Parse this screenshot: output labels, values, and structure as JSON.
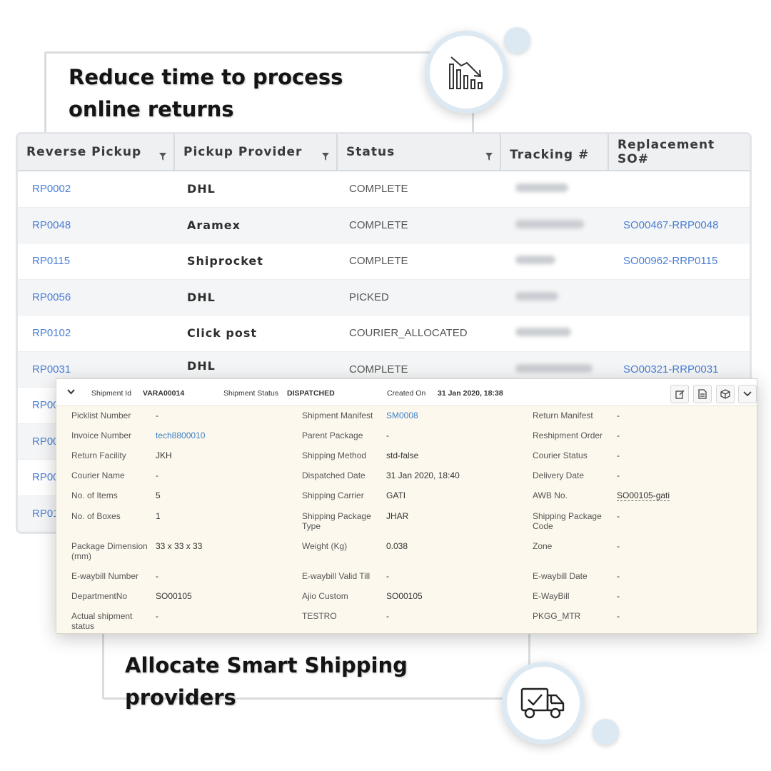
{
  "headlines": {
    "top": "Reduce time to process online returns",
    "bottom": "Allocate Smart Shipping providers"
  },
  "icons": {
    "top": "declining-bar-chart-icon",
    "bottom": "delivery-truck-check-icon"
  },
  "colors": {
    "link": "#4a7fd4",
    "panel_bg": "#fdf8ee",
    "circle_ring": "#dce9f2"
  },
  "table": {
    "headers": [
      "Reverse Pickup",
      "Pickup Provider",
      "Status",
      "Tracking #",
      "Replacement SO#"
    ],
    "rows": [
      {
        "pickup": "RP0002",
        "provider": "DHL",
        "status": "COMPLETE",
        "replacement": ""
      },
      {
        "pickup": "RP0048",
        "provider": "Aramex",
        "status": "COMPLETE",
        "replacement": "SO00467-RRP0048"
      },
      {
        "pickup": "RP0115",
        "provider": "Shiprocket",
        "status": "COMPLETE",
        "replacement": "SO00962-RRP0115"
      },
      {
        "pickup": "RP0056",
        "provider": "DHL",
        "status": "PICKED",
        "replacement": ""
      },
      {
        "pickup": "RP0102",
        "provider": "Click post",
        "status": "COURIER_ALLOCATED",
        "replacement": ""
      },
      {
        "pickup": "RP0031",
        "provider": "DHL",
        "status": "COMPLETE",
        "replacement": "SO00321-RRP0031"
      },
      {
        "pickup": "RP00",
        "provider": "",
        "status": "",
        "replacement": ""
      },
      {
        "pickup": "RP00",
        "provider": "",
        "status": "",
        "replacement": ""
      },
      {
        "pickup": "RP00",
        "provider": "",
        "status": "",
        "replacement": ""
      },
      {
        "pickup": "RP01",
        "provider": "",
        "status": "",
        "replacement": ""
      }
    ]
  },
  "shipment": {
    "id_label": "Shipment Id",
    "id_value": "VARA00014",
    "status_label": "Shipment Status",
    "status_value": "DISPATCHED",
    "created_label": "Created On",
    "created_value": "31 Jan 2020, 18:38",
    "fields": [
      [
        {
          "label": "Picklist Number",
          "value": "-"
        },
        {
          "label": "Shipment Manifest",
          "value": "SM0008",
          "link": true
        },
        {
          "label": "Return Manifest",
          "value": "-"
        }
      ],
      [
        {
          "label": "Invoice Number",
          "value": "tech8800010",
          "link": true
        },
        {
          "label": "Parent Package",
          "value": "-"
        },
        {
          "label": "Reshipment Order",
          "value": "-"
        }
      ],
      [
        {
          "label": "Return Facility",
          "value": "JKH"
        },
        {
          "label": "Shipping Method",
          "value": "std-false"
        },
        {
          "label": "Courier Status",
          "value": "-"
        }
      ],
      [
        {
          "label": "Courier Name",
          "value": "-"
        },
        {
          "label": "Dispatched Date",
          "value": "31 Jan 2020, 18:40"
        },
        {
          "label": "Delivery Date",
          "value": "-"
        }
      ],
      [
        {
          "label": "No. of Items",
          "value": "5"
        },
        {
          "label": "Shipping Carrier",
          "value": "GATI"
        },
        {
          "label": "AWB No.",
          "value": "SO00105-gati",
          "dotted": true
        }
      ],
      [
        {
          "label": "No. of Boxes",
          "value": "1"
        },
        {
          "label": "Shipping Package Type",
          "value": "JHAR"
        },
        {
          "label": "Shipping Package Code",
          "value": "-"
        }
      ],
      [
        {
          "label": "Package Dimension (mm)",
          "value": "33 x 33 x 33"
        },
        {
          "label": "Weight (Kg)",
          "value": "0.038"
        },
        {
          "label": "Zone",
          "value": "-"
        }
      ],
      [
        {
          "label": "E-waybill Number",
          "value": "-"
        },
        {
          "label": "E-waybill Valid Till",
          "value": "-"
        },
        {
          "label": "E-waybill Date",
          "value": "-"
        }
      ],
      [
        {
          "label": "DepartmentNo",
          "value": "SO00105"
        },
        {
          "label": "Ajio Custom",
          "value": "SO00105"
        },
        {
          "label": "E-WayBill",
          "value": "-"
        }
      ],
      [
        {
          "label": "Actual shipment status",
          "value": "-"
        },
        {
          "label": "TESTRO",
          "value": "-"
        },
        {
          "label": "PKGG_MTR",
          "value": "-"
        }
      ]
    ]
  }
}
